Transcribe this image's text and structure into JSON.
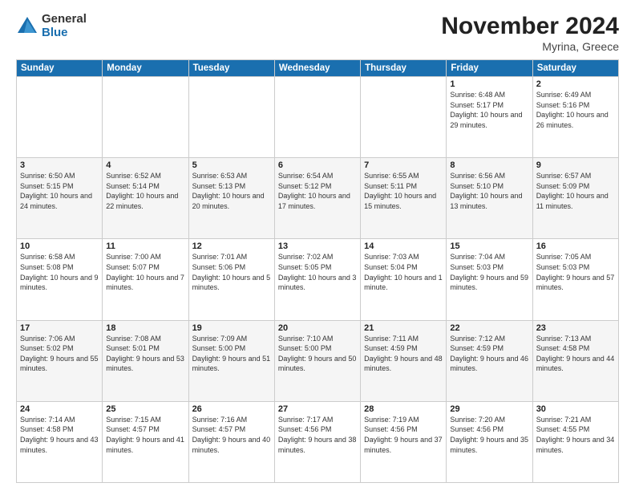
{
  "logo": {
    "general": "General",
    "blue": "Blue"
  },
  "title": {
    "month": "November 2024",
    "location": "Myrina, Greece"
  },
  "weekdays": [
    "Sunday",
    "Monday",
    "Tuesday",
    "Wednesday",
    "Thursday",
    "Friday",
    "Saturday"
  ],
  "weeks": [
    [
      {
        "day": "",
        "info": ""
      },
      {
        "day": "",
        "info": ""
      },
      {
        "day": "",
        "info": ""
      },
      {
        "day": "",
        "info": ""
      },
      {
        "day": "",
        "info": ""
      },
      {
        "day": "1",
        "info": "Sunrise: 6:48 AM\nSunset: 5:17 PM\nDaylight: 10 hours and 29 minutes."
      },
      {
        "day": "2",
        "info": "Sunrise: 6:49 AM\nSunset: 5:16 PM\nDaylight: 10 hours and 26 minutes."
      }
    ],
    [
      {
        "day": "3",
        "info": "Sunrise: 6:50 AM\nSunset: 5:15 PM\nDaylight: 10 hours and 24 minutes."
      },
      {
        "day": "4",
        "info": "Sunrise: 6:52 AM\nSunset: 5:14 PM\nDaylight: 10 hours and 22 minutes."
      },
      {
        "day": "5",
        "info": "Sunrise: 6:53 AM\nSunset: 5:13 PM\nDaylight: 10 hours and 20 minutes."
      },
      {
        "day": "6",
        "info": "Sunrise: 6:54 AM\nSunset: 5:12 PM\nDaylight: 10 hours and 17 minutes."
      },
      {
        "day": "7",
        "info": "Sunrise: 6:55 AM\nSunset: 5:11 PM\nDaylight: 10 hours and 15 minutes."
      },
      {
        "day": "8",
        "info": "Sunrise: 6:56 AM\nSunset: 5:10 PM\nDaylight: 10 hours and 13 minutes."
      },
      {
        "day": "9",
        "info": "Sunrise: 6:57 AM\nSunset: 5:09 PM\nDaylight: 10 hours and 11 minutes."
      }
    ],
    [
      {
        "day": "10",
        "info": "Sunrise: 6:58 AM\nSunset: 5:08 PM\nDaylight: 10 hours and 9 minutes."
      },
      {
        "day": "11",
        "info": "Sunrise: 7:00 AM\nSunset: 5:07 PM\nDaylight: 10 hours and 7 minutes."
      },
      {
        "day": "12",
        "info": "Sunrise: 7:01 AM\nSunset: 5:06 PM\nDaylight: 10 hours and 5 minutes."
      },
      {
        "day": "13",
        "info": "Sunrise: 7:02 AM\nSunset: 5:05 PM\nDaylight: 10 hours and 3 minutes."
      },
      {
        "day": "14",
        "info": "Sunrise: 7:03 AM\nSunset: 5:04 PM\nDaylight: 10 hours and 1 minute."
      },
      {
        "day": "15",
        "info": "Sunrise: 7:04 AM\nSunset: 5:03 PM\nDaylight: 9 hours and 59 minutes."
      },
      {
        "day": "16",
        "info": "Sunrise: 7:05 AM\nSunset: 5:03 PM\nDaylight: 9 hours and 57 minutes."
      }
    ],
    [
      {
        "day": "17",
        "info": "Sunrise: 7:06 AM\nSunset: 5:02 PM\nDaylight: 9 hours and 55 minutes."
      },
      {
        "day": "18",
        "info": "Sunrise: 7:08 AM\nSunset: 5:01 PM\nDaylight: 9 hours and 53 minutes."
      },
      {
        "day": "19",
        "info": "Sunrise: 7:09 AM\nSunset: 5:00 PM\nDaylight: 9 hours and 51 minutes."
      },
      {
        "day": "20",
        "info": "Sunrise: 7:10 AM\nSunset: 5:00 PM\nDaylight: 9 hours and 50 minutes."
      },
      {
        "day": "21",
        "info": "Sunrise: 7:11 AM\nSunset: 4:59 PM\nDaylight: 9 hours and 48 minutes."
      },
      {
        "day": "22",
        "info": "Sunrise: 7:12 AM\nSunset: 4:59 PM\nDaylight: 9 hours and 46 minutes."
      },
      {
        "day": "23",
        "info": "Sunrise: 7:13 AM\nSunset: 4:58 PM\nDaylight: 9 hours and 44 minutes."
      }
    ],
    [
      {
        "day": "24",
        "info": "Sunrise: 7:14 AM\nSunset: 4:58 PM\nDaylight: 9 hours and 43 minutes."
      },
      {
        "day": "25",
        "info": "Sunrise: 7:15 AM\nSunset: 4:57 PM\nDaylight: 9 hours and 41 minutes."
      },
      {
        "day": "26",
        "info": "Sunrise: 7:16 AM\nSunset: 4:57 PM\nDaylight: 9 hours and 40 minutes."
      },
      {
        "day": "27",
        "info": "Sunrise: 7:17 AM\nSunset: 4:56 PM\nDaylight: 9 hours and 38 minutes."
      },
      {
        "day": "28",
        "info": "Sunrise: 7:19 AM\nSunset: 4:56 PM\nDaylight: 9 hours and 37 minutes."
      },
      {
        "day": "29",
        "info": "Sunrise: 7:20 AM\nSunset: 4:56 PM\nDaylight: 9 hours and 35 minutes."
      },
      {
        "day": "30",
        "info": "Sunrise: 7:21 AM\nSunset: 4:55 PM\nDaylight: 9 hours and 34 minutes."
      }
    ]
  ]
}
